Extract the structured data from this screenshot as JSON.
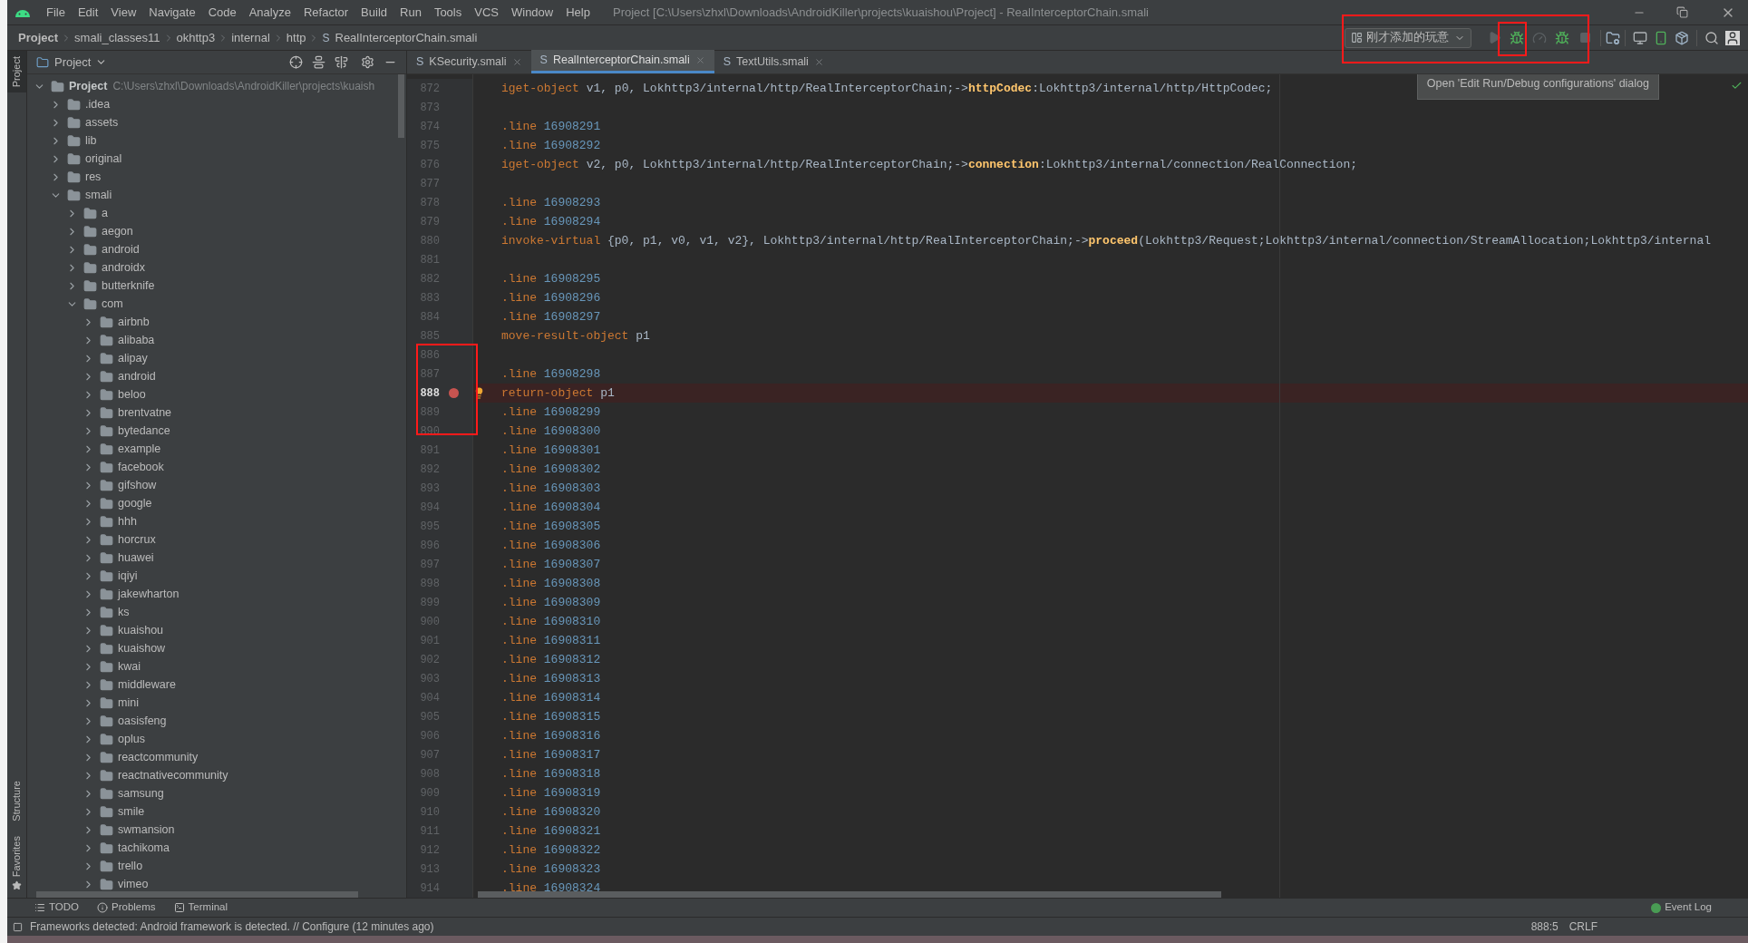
{
  "menu": [
    "File",
    "Edit",
    "View",
    "Navigate",
    "Code",
    "Analyze",
    "Refactor",
    "Build",
    "Run",
    "Tools",
    "VCS",
    "Window",
    "Help"
  ],
  "window": {
    "title": "Project [C:\\Users\\zhxl\\Downloads\\AndroidKiller\\projects\\kuaishou\\Project] - RealInterceptorChain.smali"
  },
  "breadcrumb": [
    {
      "label": "Project"
    },
    {
      "label": "smali_classes11"
    },
    {
      "label": "okhttp3"
    },
    {
      "label": "internal"
    },
    {
      "label": "http"
    },
    {
      "label": "RealInterceptorChain.smali",
      "badge": "S"
    }
  ],
  "toolbar": {
    "config": "刚才添加的玩意",
    "buttons": [
      {
        "kind": "run",
        "enabled": false
      },
      {
        "kind": "debug",
        "enabled": true
      },
      {
        "kind": "profile",
        "enabled": false
      },
      {
        "kind": "attach",
        "enabled": true
      },
      {
        "kind": "stop",
        "enabled": false
      }
    ]
  },
  "tooltip": "Open 'Edit Run/Debug configurations' dialog",
  "side_strip": [
    "Project",
    "Structure",
    "Favorites"
  ],
  "project_panel": {
    "title": "Project",
    "tree": [
      {
        "label": "Project",
        "path": "C:\\Users\\zhxl\\Downloads\\AndroidKiller\\projects\\kuaish",
        "expanded": true,
        "children": [
          {
            "label": ".idea",
            "expanded": false
          },
          {
            "label": "assets",
            "expanded": false
          },
          {
            "label": "lib",
            "expanded": false
          },
          {
            "label": "original",
            "expanded": false
          },
          {
            "label": "res",
            "expanded": false
          },
          {
            "label": "smali",
            "expanded": true,
            "children": [
              {
                "label": "a",
                "expanded": false
              },
              {
                "label": "aegon",
                "expanded": false
              },
              {
                "label": "android",
                "expanded": false
              },
              {
                "label": "androidx",
                "expanded": false
              },
              {
                "label": "butterknife",
                "expanded": false
              },
              {
                "label": "com",
                "expanded": true,
                "children": [
                  {
                    "label": "airbnb",
                    "expanded": false
                  },
                  {
                    "label": "alibaba",
                    "expanded": false
                  },
                  {
                    "label": "alipay",
                    "expanded": false
                  },
                  {
                    "label": "android",
                    "expanded": false
                  },
                  {
                    "label": "beloo",
                    "expanded": false
                  },
                  {
                    "label": "brentvatne",
                    "expanded": false
                  },
                  {
                    "label": "bytedance",
                    "expanded": false
                  },
                  {
                    "label": "example",
                    "expanded": false
                  },
                  {
                    "label": "facebook",
                    "expanded": false
                  },
                  {
                    "label": "gifshow",
                    "expanded": false
                  },
                  {
                    "label": "google",
                    "expanded": false
                  },
                  {
                    "label": "hhh",
                    "expanded": false
                  },
                  {
                    "label": "horcrux",
                    "expanded": false
                  },
                  {
                    "label": "huawei",
                    "expanded": false
                  },
                  {
                    "label": "iqiyi",
                    "expanded": false
                  },
                  {
                    "label": "jakewharton",
                    "expanded": false
                  },
                  {
                    "label": "ks",
                    "expanded": false
                  },
                  {
                    "label": "kuaishou",
                    "expanded": false
                  },
                  {
                    "label": "kuaishow",
                    "expanded": false
                  },
                  {
                    "label": "kwai",
                    "expanded": false
                  },
                  {
                    "label": "middleware",
                    "expanded": false
                  },
                  {
                    "label": "mini",
                    "expanded": false
                  },
                  {
                    "label": "oasisfeng",
                    "expanded": false
                  },
                  {
                    "label": "oplus",
                    "expanded": false
                  },
                  {
                    "label": "reactcommunity",
                    "expanded": false
                  },
                  {
                    "label": "reactnativecommunity",
                    "expanded": false
                  },
                  {
                    "label": "samsung",
                    "expanded": false
                  },
                  {
                    "label": "smile",
                    "expanded": false
                  },
                  {
                    "label": "swmansion",
                    "expanded": false
                  },
                  {
                    "label": "tachikoma",
                    "expanded": false
                  },
                  {
                    "label": "trello",
                    "expanded": false
                  },
                  {
                    "label": "vimeo",
                    "expanded": false
                  }
                ]
              }
            ]
          }
        ]
      }
    ]
  },
  "tabs": [
    {
      "badge": "S",
      "label": "KSecurity.smali",
      "selected": false
    },
    {
      "badge": "S",
      "label": "RealInterceptorChain.smali",
      "selected": true
    },
    {
      "badge": "S",
      "label": "TextUtils.smali",
      "selected": false
    }
  ],
  "code": [
    {
      "n": "872",
      "breakpoint": false,
      "segments": [
        {
          "t": "iget-object",
          "kind": "keyword"
        },
        {
          "t": " v1, p0, Lokhttp3/internal/http/RealInterceptorChain;->",
          "kind": "plain"
        },
        {
          "t": "httpCodec",
          "kind": "member"
        },
        {
          "t": ":Lokhttp3/internal/http/HttpCodec;",
          "kind": "plain"
        }
      ]
    },
    {
      "n": "873",
      "breakpoint": false
    },
    {
      "n": "874",
      "breakpoint": false,
      "segments": [
        {
          "t": ".line",
          "kind": "keyword"
        },
        {
          "t": " 16908291",
          "kind": "number"
        }
      ]
    },
    {
      "n": "875",
      "breakpoint": false,
      "segments": [
        {
          "t": ".line",
          "kind": "keyword"
        },
        {
          "t": " 16908292",
          "kind": "number"
        }
      ]
    },
    {
      "n": "876",
      "breakpoint": false,
      "segments": [
        {
          "t": "iget-object",
          "kind": "keyword"
        },
        {
          "t": " v2, p0, Lokhttp3/internal/http/RealInterceptorChain;->",
          "kind": "plain"
        },
        {
          "t": "connection",
          "kind": "member"
        },
        {
          "t": ":Lokhttp3/internal/connection/RealConnection;",
          "kind": "plain"
        }
      ]
    },
    {
      "n": "877",
      "breakpoint": false
    },
    {
      "n": "878",
      "breakpoint": false,
      "segments": [
        {
          "t": ".line",
          "kind": "keyword"
        },
        {
          "t": " 16908293",
          "kind": "number"
        }
      ]
    },
    {
      "n": "879",
      "breakpoint": false,
      "segments": [
        {
          "t": ".line",
          "kind": "keyword"
        },
        {
          "t": " 16908294",
          "kind": "number"
        }
      ]
    },
    {
      "n": "880",
      "breakpoint": false,
      "segments": [
        {
          "t": "invoke-virtual",
          "kind": "keyword"
        },
        {
          "t": " {p0, p1, v0, v1, v2}, Lokhttp3/internal/http/RealInterceptorChain;->",
          "kind": "plain"
        },
        {
          "t": "proceed",
          "kind": "member"
        },
        {
          "t": "(Lokhttp3/Request;Lokhttp3/internal/connection/StreamAllocation;Lokhttp3/internal",
          "kind": "plain"
        }
      ]
    },
    {
      "n": "881",
      "breakpoint": false
    },
    {
      "n": "882",
      "breakpoint": false,
      "segments": [
        {
          "t": ".line",
          "kind": "keyword"
        },
        {
          "t": " 16908295",
          "kind": "number"
        }
      ]
    },
    {
      "n": "883",
      "breakpoint": false,
      "segments": [
        {
          "t": ".line",
          "kind": "keyword"
        },
        {
          "t": " 16908296",
          "kind": "number"
        }
      ]
    },
    {
      "n": "884",
      "breakpoint": false,
      "segments": [
        {
          "t": ".line",
          "kind": "keyword"
        },
        {
          "t": " 16908297",
          "kind": "number"
        }
      ]
    },
    {
      "n": "885",
      "breakpoint": false,
      "segments": [
        {
          "t": "move-result-object",
          "kind": "keyword"
        },
        {
          "t": " p1",
          "kind": "plain"
        }
      ]
    },
    {
      "n": "886",
      "breakpoint": false
    },
    {
      "n": "887",
      "breakpoint": false,
      "segments": [
        {
          "t": ".line",
          "kind": "keyword"
        },
        {
          "t": " 16908298",
          "kind": "number"
        }
      ]
    },
    {
      "n": "888",
      "breakpoint": true,
      "segments": [
        {
          "t": "return-object",
          "kind": "keyword"
        },
        {
          "t": " p1",
          "kind": "plain"
        }
      ]
    },
    {
      "n": "889",
      "breakpoint": false,
      "segments": [
        {
          "t": ".line",
          "kind": "keyword"
        },
        {
          "t": " 16908299",
          "kind": "number"
        }
      ]
    },
    {
      "n": "890",
      "breakpoint": false,
      "segments": [
        {
          "t": ".line",
          "kind": "keyword"
        },
        {
          "t": " 16908300",
          "kind": "number"
        }
      ]
    },
    {
      "n": "891",
      "breakpoint": false,
      "segments": [
        {
          "t": ".line",
          "kind": "keyword"
        },
        {
          "t": " 16908301",
          "kind": "number"
        }
      ]
    },
    {
      "n": "892",
      "breakpoint": false,
      "segments": [
        {
          "t": ".line",
          "kind": "keyword"
        },
        {
          "t": " 16908302",
          "kind": "number"
        }
      ]
    },
    {
      "n": "893",
      "breakpoint": false,
      "segments": [
        {
          "t": ".line",
          "kind": "keyword"
        },
        {
          "t": " 16908303",
          "kind": "number"
        }
      ]
    },
    {
      "n": "894",
      "breakpoint": false,
      "segments": [
        {
          "t": ".line",
          "kind": "keyword"
        },
        {
          "t": " 16908304",
          "kind": "number"
        }
      ]
    },
    {
      "n": "895",
      "breakpoint": false,
      "segments": [
        {
          "t": ".line",
          "kind": "keyword"
        },
        {
          "t": " 16908305",
          "kind": "number"
        }
      ]
    },
    {
      "n": "896",
      "breakpoint": false,
      "segments": [
        {
          "t": ".line",
          "kind": "keyword"
        },
        {
          "t": " 16908306",
          "kind": "number"
        }
      ]
    },
    {
      "n": "897",
      "breakpoint": false,
      "segments": [
        {
          "t": ".line",
          "kind": "keyword"
        },
        {
          "t": " 16908307",
          "kind": "number"
        }
      ]
    },
    {
      "n": "898",
      "breakpoint": false,
      "segments": [
        {
          "t": ".line",
          "kind": "keyword"
        },
        {
          "t": " 16908308",
          "kind": "number"
        }
      ]
    },
    {
      "n": "899",
      "breakpoint": false,
      "segments": [
        {
          "t": ".line",
          "kind": "keyword"
        },
        {
          "t": " 16908309",
          "kind": "number"
        }
      ]
    },
    {
      "n": "900",
      "breakpoint": false,
      "segments": [
        {
          "t": ".line",
          "kind": "keyword"
        },
        {
          "t": " 16908310",
          "kind": "number"
        }
      ]
    },
    {
      "n": "901",
      "breakpoint": false,
      "segments": [
        {
          "t": ".line",
          "kind": "keyword"
        },
        {
          "t": " 16908311",
          "kind": "number"
        }
      ]
    },
    {
      "n": "902",
      "breakpoint": false,
      "segments": [
        {
          "t": ".line",
          "kind": "keyword"
        },
        {
          "t": " 16908312",
          "kind": "number"
        }
      ]
    },
    {
      "n": "903",
      "breakpoint": false,
      "segments": [
        {
          "t": ".line",
          "kind": "keyword"
        },
        {
          "t": " 16908313",
          "kind": "number"
        }
      ]
    },
    {
      "n": "904",
      "breakpoint": false,
      "segments": [
        {
          "t": ".line",
          "kind": "keyword"
        },
        {
          "t": " 16908314",
          "kind": "number"
        }
      ]
    },
    {
      "n": "905",
      "breakpoint": false,
      "segments": [
        {
          "t": ".line",
          "kind": "keyword"
        },
        {
          "t": " 16908315",
          "kind": "number"
        }
      ]
    },
    {
      "n": "906",
      "breakpoint": false,
      "segments": [
        {
          "t": ".line",
          "kind": "keyword"
        },
        {
          "t": " 16908316",
          "kind": "number"
        }
      ]
    },
    {
      "n": "907",
      "breakpoint": false,
      "segments": [
        {
          "t": ".line",
          "kind": "keyword"
        },
        {
          "t": " 16908317",
          "kind": "number"
        }
      ]
    },
    {
      "n": "908",
      "breakpoint": false,
      "segments": [
        {
          "t": ".line",
          "kind": "keyword"
        },
        {
          "t": " 16908318",
          "kind": "number"
        }
      ]
    },
    {
      "n": "909",
      "breakpoint": false,
      "segments": [
        {
          "t": ".line",
          "kind": "keyword"
        },
        {
          "t": " 16908319",
          "kind": "number"
        }
      ]
    },
    {
      "n": "910",
      "breakpoint": false,
      "segments": [
        {
          "t": ".line",
          "kind": "keyword"
        },
        {
          "t": " 16908320",
          "kind": "number"
        }
      ]
    },
    {
      "n": "911",
      "breakpoint": false,
      "segments": [
        {
          "t": ".line",
          "kind": "keyword"
        },
        {
          "t": " 16908321",
          "kind": "number"
        }
      ]
    },
    {
      "n": "912",
      "breakpoint": false,
      "segments": [
        {
          "t": ".line",
          "kind": "keyword"
        },
        {
          "t": " 16908322",
          "kind": "number"
        }
      ]
    },
    {
      "n": "913",
      "breakpoint": false,
      "segments": [
        {
          "t": ".line",
          "kind": "keyword"
        },
        {
          "t": " 16908323",
          "kind": "number"
        }
      ]
    },
    {
      "n": "914",
      "breakpoint": false,
      "segments": [
        {
          "t": ".line",
          "kind": "keyword"
        },
        {
          "t": " 16908324",
          "kind": "number"
        }
      ]
    }
  ],
  "bottom_tools": [
    {
      "kind": "todo",
      "label": "TODO"
    },
    {
      "kind": "problems",
      "label": "Problems"
    },
    {
      "kind": "terminal",
      "label": "Terminal"
    }
  ],
  "event_log": "Event Log",
  "status_bar": {
    "message": "Frameworks detected: Android framework is detected. // Configure (12 minutes ago)",
    "position": "888:5",
    "line_separator": "CRLF"
  }
}
